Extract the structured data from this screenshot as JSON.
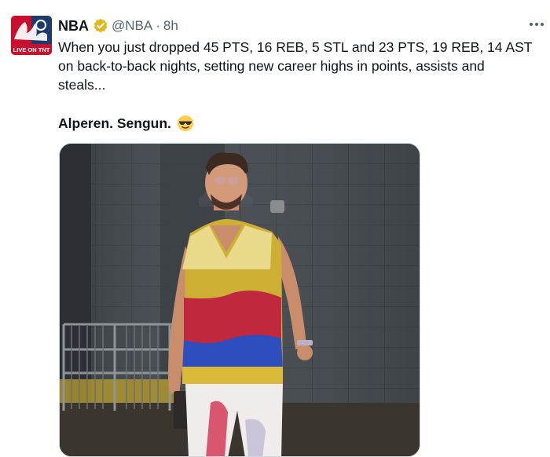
{
  "post": {
    "author_name": "NBA",
    "handle": "@NBA",
    "separator": "·",
    "time": "8h",
    "avatar_text": "LIVE ON TNT",
    "text_lines": [
      "When you just dropped 45 PTS, 16 REB, 5 STL and 23 PTS, 19 REB, 14 AST",
      "on back-to-back nights, setting new career highs in points, assists and",
      "steals..."
    ],
    "bold_text": "Alperen. Sengun.",
    "emoji": "smiling-face-with-sunglasses",
    "verified_badge_color": "#e2b719",
    "more_icon": "more-horizontal-icon"
  },
  "colors": {
    "text": "#0f1419",
    "secondary_text": "#536471",
    "border": "#cfd9de",
    "avatar_red": "#c8102e",
    "avatar_navy": "#1d3a6e"
  }
}
